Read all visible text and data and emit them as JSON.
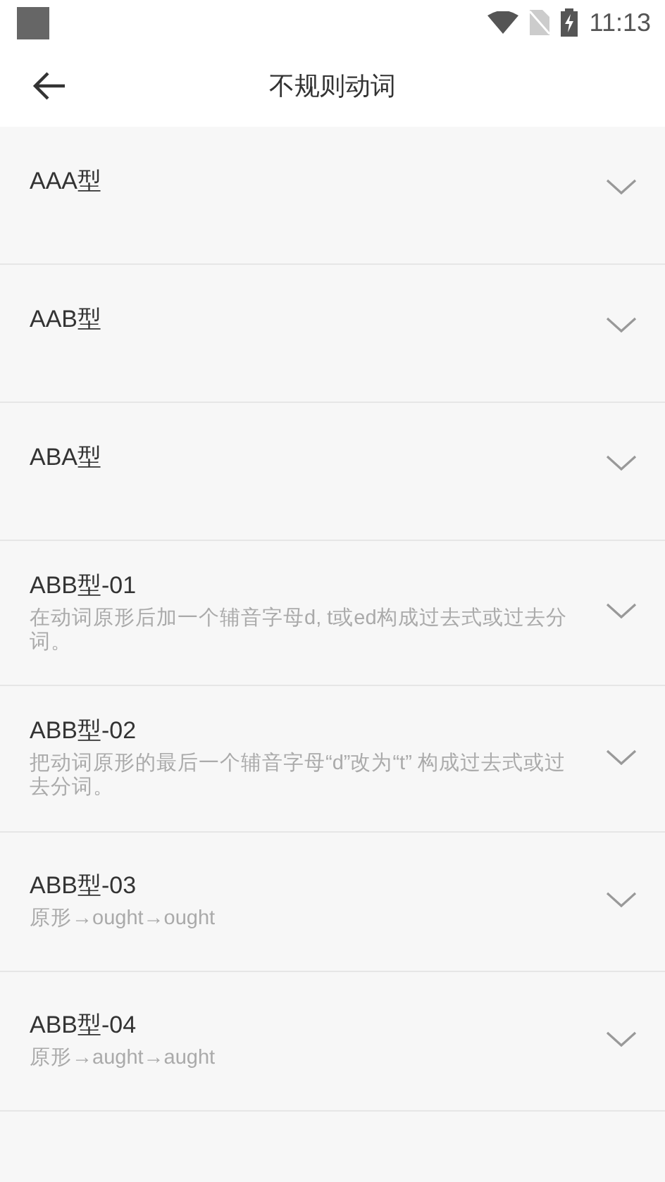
{
  "status_bar": {
    "time": "11:13"
  },
  "header": {
    "title": "不规则动词"
  },
  "items": [
    {
      "title": "AAA型",
      "expanded": false
    },
    {
      "title": "AAB型",
      "expanded": false
    },
    {
      "title": "ABA型",
      "expanded": false
    },
    {
      "title": "ABB型-01",
      "description": "在动词原形后加一个辅音字母d, t或ed构成过去式或过去分词。",
      "expanded": false
    },
    {
      "title": "ABB型-02",
      "description": "把动词原形的最后一个辅音字母“d”改为“t” 构成过去式或过去分词。",
      "expanded": false
    },
    {
      "title": "ABB型-03",
      "description": "原形→ought→ought",
      "expanded": false
    },
    {
      "title": "ABB型-04",
      "description": "原形→aught→aught",
      "expanded": false
    }
  ]
}
